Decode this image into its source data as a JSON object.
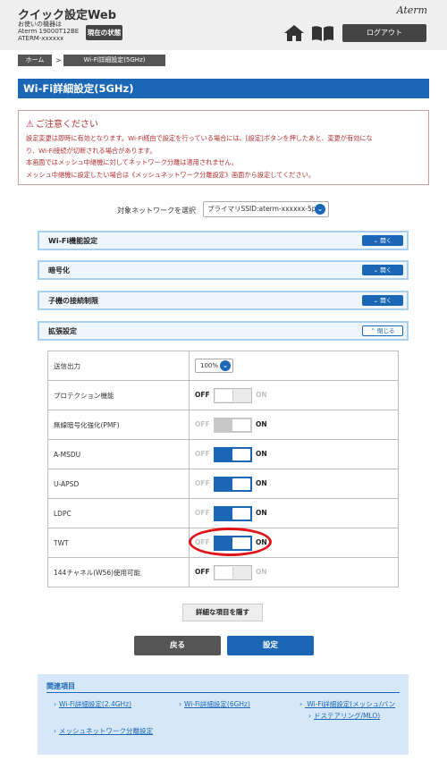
{
  "header": {
    "app_title": "クイック設定Web",
    "device_line1": "お使いの機器は",
    "device_line2": "Aterm 19000T12BE",
    "device_line3": "ATERM-xxxxxx",
    "status_button": "現在の状態",
    "brand": "Aterm",
    "logout_button": "ログアウト"
  },
  "breadcrumb": {
    "home": "ホーム",
    "separator": ">",
    "current": "Wi-Fi詳細設定(5GHz)"
  },
  "page_title": "Wi-Fi詳細設定(5GHz)",
  "caution": {
    "title": "ご注意ください",
    "line1": "設定変更は即時に有効となります。Wi-Fi経由で設定を行っている場合には、[設定]ボタンを押したあと、変更が有効にな",
    "line2": "り、Wi-Fi接続が切断される場合があります。",
    "line3": "本画面ではメッシュ中継機に対してネットワーク分離は適用されません。",
    "line4": "メッシュ中継機に設定したい場合は《メッシュネットワーク分離設定》画面から設定してください。"
  },
  "network_select": {
    "label": "対象ネットワークを選択",
    "value": "プライマリSSID:aterm-xxxxxx-5p"
  },
  "sections": [
    {
      "title": "Wi-Fi機能設定",
      "button": "開く"
    },
    {
      "title": "暗号化",
      "button": "開く"
    },
    {
      "title": "子機の接続制限",
      "button": "開く"
    },
    {
      "title": "拡張設定",
      "button": "閉じる"
    }
  ],
  "settings": {
    "tx_power": {
      "label": "送信出力",
      "value": "100%"
    },
    "protection": {
      "label": "プロテクション機能",
      "off": "OFF",
      "on": "ON",
      "state": "off"
    },
    "pmf": {
      "label": "無線暗号化強化(PMF)",
      "off": "OFF",
      "on": "ON",
      "state": "on-disabled"
    },
    "amsdu": {
      "label": "A-MSDU",
      "off": "OFF",
      "on": "ON",
      "state": "on"
    },
    "uapsd": {
      "label": "U-APSD",
      "off": "OFF",
      "on": "ON",
      "state": "on"
    },
    "ldpc": {
      "label": "LDPC",
      "off": "OFF",
      "on": "ON",
      "state": "on"
    },
    "twt": {
      "label": "TWT",
      "off": "OFF",
      "on": "ON",
      "state": "on"
    },
    "ch144": {
      "label": "144チャネル(W56)使用可能",
      "off": "OFF",
      "on": "ON",
      "state": "off"
    }
  },
  "buttons": {
    "hide_details": "詳細な項目を隠す",
    "back": "戻る",
    "submit": "設定"
  },
  "related": {
    "title": "関連項目",
    "link1": "Wi-Fi詳細設定(2.4GHz)",
    "link2": "Wi-Fi詳細設定(6GHz)",
    "link3a": "Wi-Fi詳細設定(メッシュ/バン",
    "link3b": "ドステアリング/MLO)",
    "link4": "メッシュネットワーク分離設定"
  },
  "colors": {
    "accent": "#1b66b5",
    "caution_text": "#b23030",
    "highlight": "#e0151a"
  }
}
